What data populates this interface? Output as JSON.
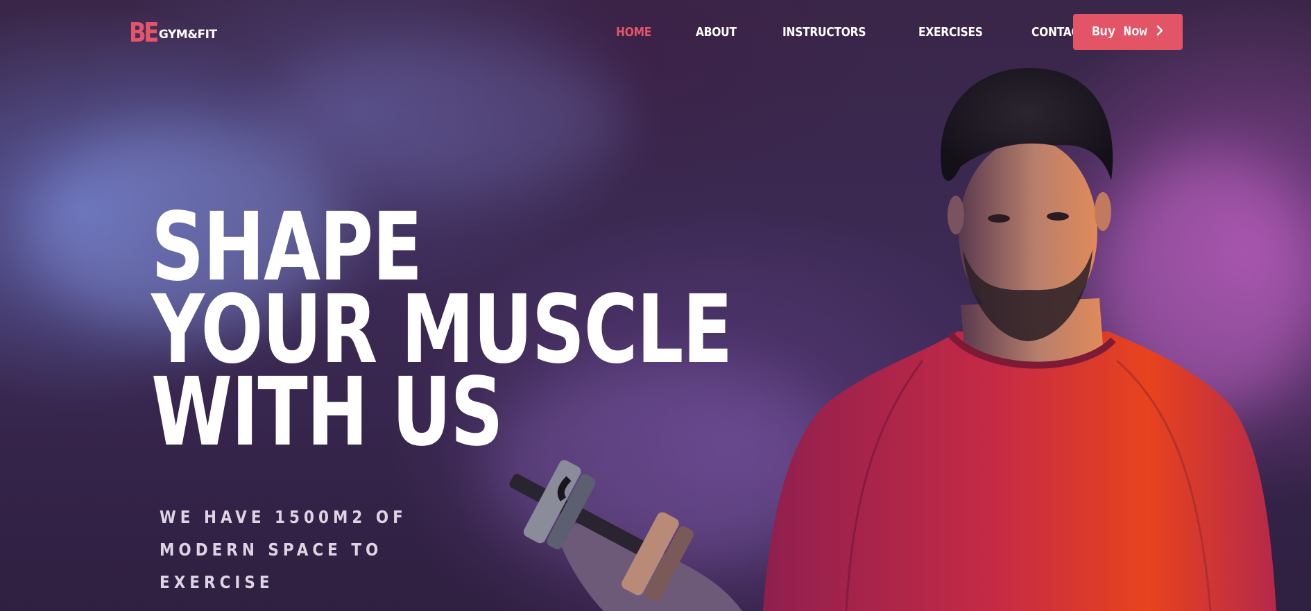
{
  "logo": {
    "mark": "BE",
    "text": "GYM&FIT"
  },
  "nav": {
    "items": [
      {
        "label": "HOME",
        "active": true
      },
      {
        "label": "ABOUT",
        "active": false
      },
      {
        "label": "INSTRUCTORS",
        "active": false
      },
      {
        "label": "EXERCISES",
        "active": false
      },
      {
        "label": "CONTACT",
        "active": false
      }
    ],
    "cta_label": "Buy Now"
  },
  "hero": {
    "headline_lines": [
      "SHAPE",
      "YOUR MUSCLE",
      "WITH US"
    ],
    "subline_lines": [
      "WE HAVE 1500M2 OF",
      "MODERN SPACE TO",
      "EXERCISE"
    ]
  },
  "colors": {
    "accent": "#e25466",
    "background": "#3a2648"
  },
  "icons": {
    "cta": "chevron-right-icon"
  }
}
